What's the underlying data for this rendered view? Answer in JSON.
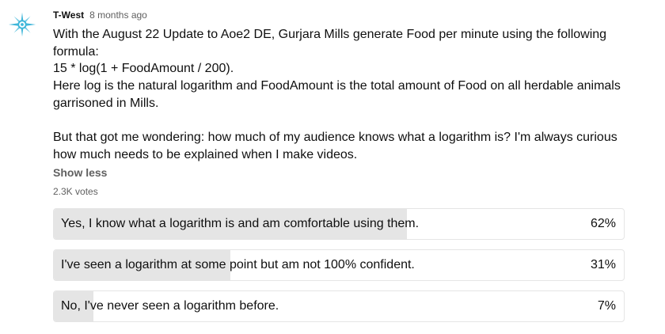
{
  "post": {
    "author": "T-West",
    "timestamp": "8 months ago",
    "body_lines": [
      "With the August 22 Update to Aoe2 DE, Gurjara Mills generate Food per minute using the following formula:",
      "15 * log(1 + FoodAmount / 200).",
      "Here log is the natural logarithm and FoodAmount is the total amount of Food on all herdable animals garrisoned in Mills.",
      "",
      "But that got me wondering: how much of my audience knows what a logarithm is? I'm always curious how much needs to be explained when I make videos."
    ],
    "show_less_label": "Show less",
    "votes": "2.3K votes"
  },
  "avatar": {
    "icon": "compass-star-icon",
    "color": "#3fb6d9"
  },
  "poll": {
    "fill_color": "#e5e5e5",
    "options": [
      {
        "label": "Yes, I know what a logarithm is and am comfortable using them.",
        "percent": "62%",
        "value": 0.62
      },
      {
        "label": "I've seen a logarithm at some point but am not 100% confident.",
        "percent": "31%",
        "value": 0.31
      },
      {
        "label": "No, I've never seen a logarithm before.",
        "percent": "7%",
        "value": 0.07
      }
    ]
  }
}
